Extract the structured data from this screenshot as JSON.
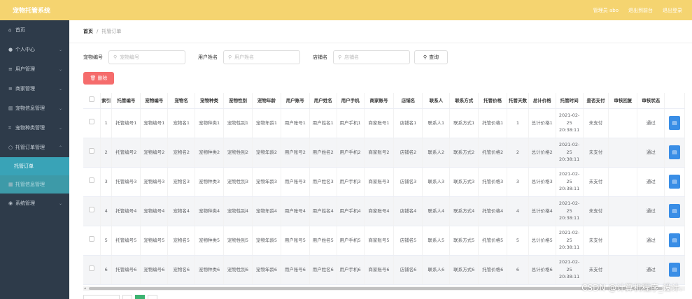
{
  "app": {
    "title": "宠物托管系统"
  },
  "topbar": {
    "user": "管理员 abo",
    "backend": "退出到前台",
    "logout": "退出登录"
  },
  "sidebar": {
    "items": [
      {
        "label": "首页",
        "icon": "home-icon"
      },
      {
        "label": "个人中心",
        "icon": "user-icon"
      },
      {
        "label": "用户管理",
        "icon": "list-icon"
      },
      {
        "label": "商家管理",
        "icon": "list-icon"
      },
      {
        "label": "宠物信息管理",
        "icon": "chart-icon"
      },
      {
        "label": "宠物种类管理",
        "icon": "frame-icon"
      },
      {
        "label": "托管订单管理",
        "icon": "circle-icon"
      },
      {
        "label": "托管订单",
        "icon": ""
      },
      {
        "label": "托管信息管理",
        "icon": "grid-icon"
      },
      {
        "label": "系统管理",
        "icon": "pin-icon"
      }
    ]
  },
  "breadcrumb": {
    "home": "首页",
    "sep": "/",
    "current": "托管订单"
  },
  "search": {
    "f1_label": "宠物编号",
    "f1_placeholder": "宠物编号",
    "f2_label": "用户姓名",
    "f2_placeholder": "用户姓名",
    "f3_label": "店铺名",
    "f3_placeholder": "店铺名",
    "button": "查询"
  },
  "toolbar": {
    "delete": "删除"
  },
  "table": {
    "headers": [
      "索引",
      "托管编号",
      "宠物编号",
      "宠物名",
      "宠物种类",
      "宠物性别",
      "宠物年龄",
      "用户账号",
      "用户姓名",
      "用户手机",
      "商家账号",
      "店铺名",
      "联系人",
      "联系方式",
      "托管价格",
      "托管天数",
      "总计价格",
      "托管时间",
      "是否支付",
      "审核回复",
      "审核状态"
    ],
    "rows": [
      [
        "1",
        "托管编号1",
        "宠物编号1",
        "宠物名1",
        "宠物种类1",
        "宠物性别1",
        "宠物年龄1",
        "用户账号1",
        "用户姓名1",
        "用户手机1",
        "商家账号1",
        "店铺名1",
        "联系人1",
        "联系方式1",
        "托管价格1",
        "1",
        "总计价格1",
        "2021-02-25 20:38:11",
        "未支付",
        "",
        "通过"
      ],
      [
        "2",
        "托管编号2",
        "宠物编号2",
        "宠物名2",
        "宠物种类2",
        "宠物性别2",
        "宠物年龄2",
        "用户账号2",
        "用户姓名2",
        "用户手机2",
        "商家账号2",
        "店铺名2",
        "联系人2",
        "联系方式2",
        "托管价格2",
        "2",
        "总计价格2",
        "2021-02-25 20:38:11",
        "未支付",
        "",
        "通过"
      ],
      [
        "3",
        "托管编号3",
        "宠物编号3",
        "宠物名3",
        "宠物种类3",
        "宠物性别3",
        "宠物年龄3",
        "用户账号3",
        "用户姓名3",
        "用户手机3",
        "商家账号3",
        "店铺名3",
        "联系人3",
        "联系方式3",
        "托管价格3",
        "3",
        "总计价格3",
        "2021-02-25 20:38:11",
        "未支付",
        "",
        "通过"
      ],
      [
        "4",
        "托管编号4",
        "宠物编号4",
        "宠物名4",
        "宠物种类4",
        "宠物性别4",
        "宠物年龄4",
        "用户账号4",
        "用户姓名4",
        "用户手机4",
        "商家账号4",
        "店铺名4",
        "联系人4",
        "联系方式4",
        "托管价格4",
        "4",
        "总计价格4",
        "2021-02-25 20:38:11",
        "未支付",
        "",
        "通过"
      ],
      [
        "5",
        "托管编号5",
        "宠物编号5",
        "宠物名5",
        "宠物种类5",
        "宠物性别5",
        "宠物年龄5",
        "用户账号5",
        "用户姓名5",
        "用户手机5",
        "商家账号5",
        "店铺名5",
        "联系人5",
        "联系方式5",
        "托管价格5",
        "5",
        "总计价格5",
        "2021-02-25 20:38:11",
        "未支付",
        "",
        "通过"
      ],
      [
        "6",
        "托管编号6",
        "宠物编号6",
        "宠物名6",
        "宠物种类6",
        "宠物性别6",
        "宠物年龄6",
        "用户账号6",
        "用户姓名6",
        "用户手机6",
        "商家账号6",
        "店铺名6",
        "联系人6",
        "联系方式6",
        "托管价格6",
        "6",
        "总计价格6",
        "2021-02-25 20:38:11",
        "未支付",
        "",
        "通过"
      ]
    ]
  },
  "watermark": "CSDN @计算机程序_设计.",
  "colors": {
    "topbar": "#f5d470",
    "sidebar": "#2e3b4a",
    "active": "#39a3b7",
    "delete": "#f56c6c",
    "op": "#3a8ee6"
  }
}
